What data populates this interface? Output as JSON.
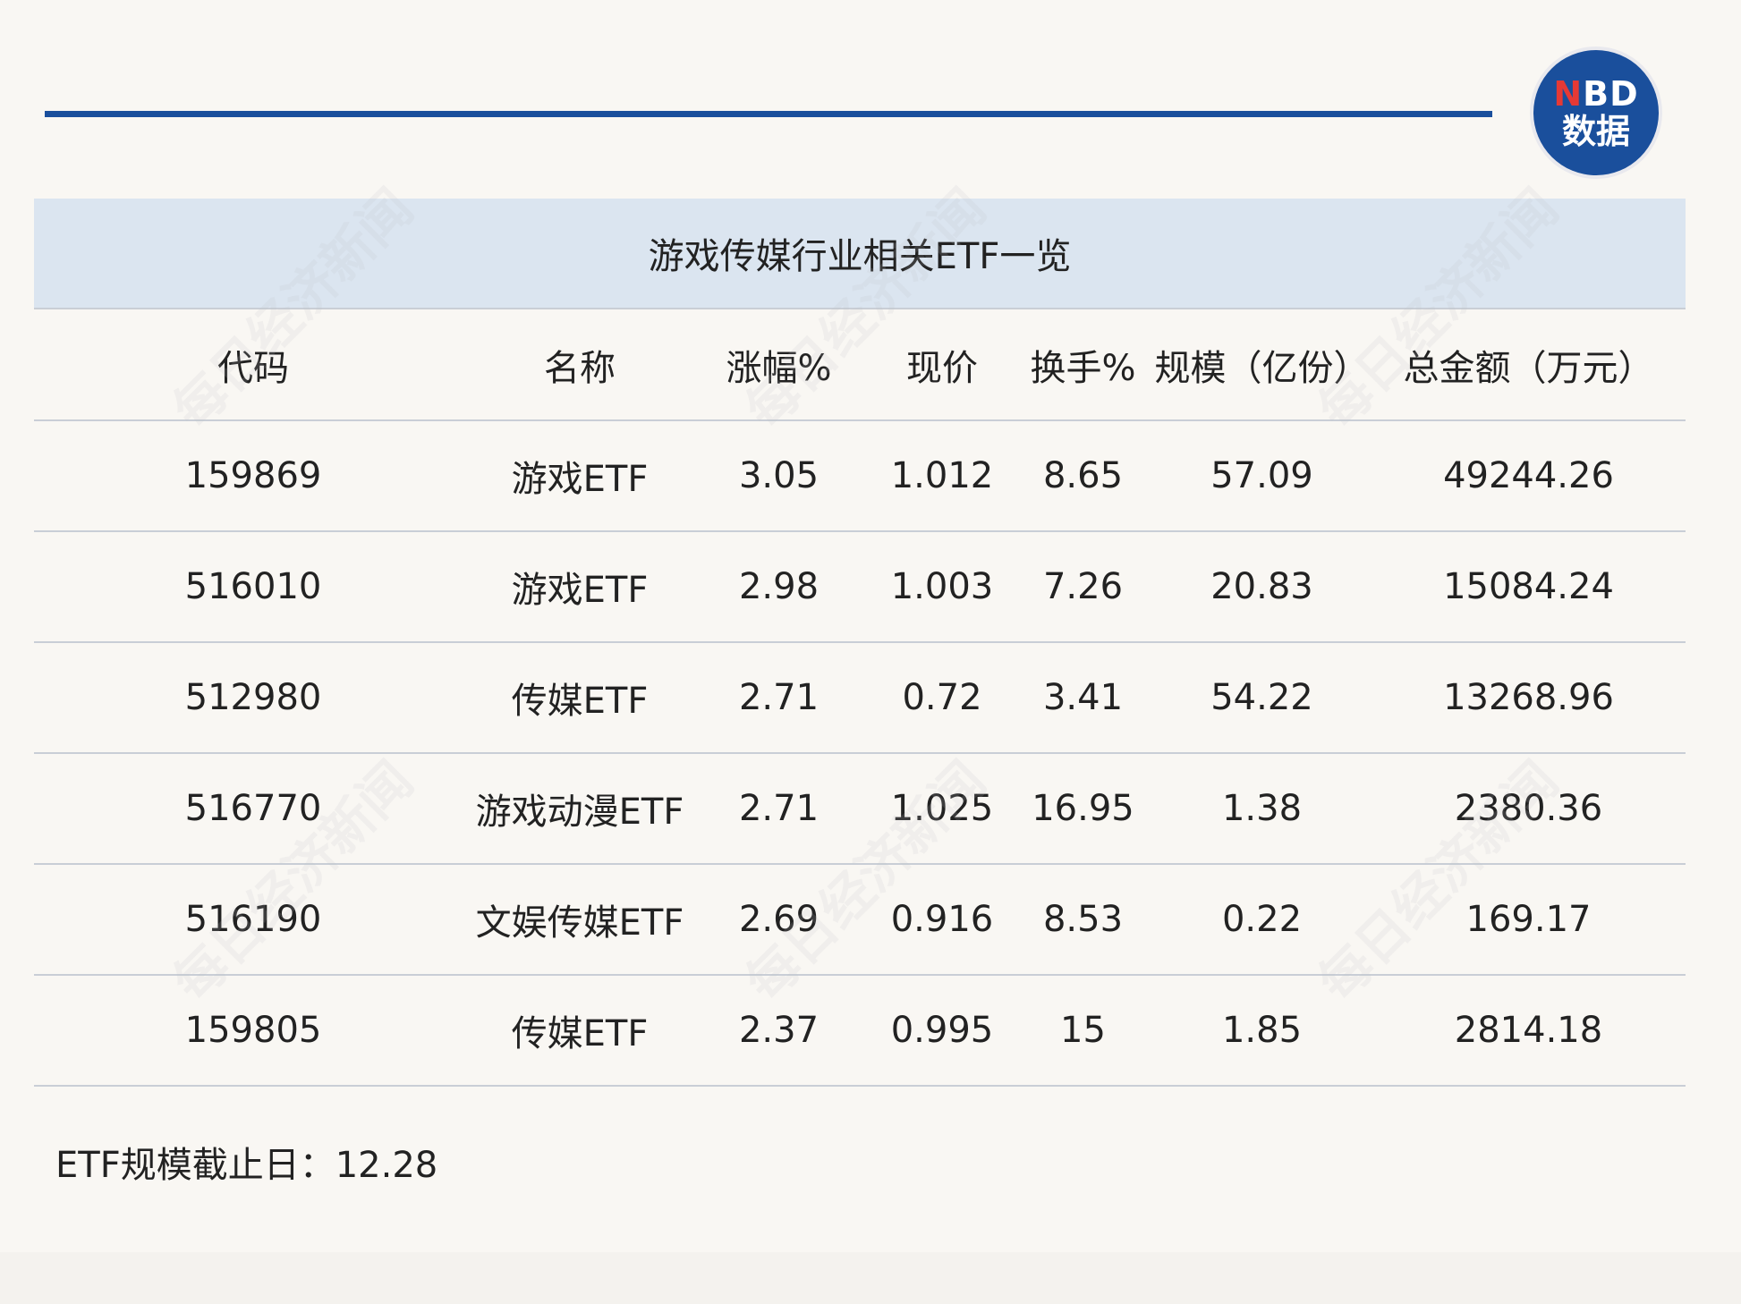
{
  "logo": {
    "latin_n": "N",
    "latin_rest": "BD",
    "cn": "数据"
  },
  "title": "游戏传媒行业相关ETF一览",
  "table": {
    "headers": [
      "代码",
      "名称",
      "涨幅%",
      "现价",
      "换手%",
      "规模（亿份）",
      "总金额（万元）"
    ],
    "rows": [
      [
        "159869",
        "游戏ETF",
        "3.05",
        "1.012",
        "8.65",
        "57.09",
        "49244.26"
      ],
      [
        "516010",
        "游戏ETF",
        "2.98",
        "1.003",
        "7.26",
        "20.83",
        "15084.24"
      ],
      [
        "512980",
        "传媒ETF",
        "2.71",
        "0.72",
        "3.41",
        "54.22",
        "13268.96"
      ],
      [
        "516770",
        "游戏动漫ETF",
        "2.71",
        "1.025",
        "16.95",
        "1.38",
        "2380.36"
      ],
      [
        "516190",
        "文娱传媒ETF",
        "2.69",
        "0.916",
        "8.53",
        "0.22",
        "169.17"
      ],
      [
        "159805",
        "传媒ETF",
        "2.37",
        "0.995",
        "15",
        "1.85",
        "2814.18"
      ]
    ]
  },
  "footnote": "ETF规模截止日：12.28",
  "watermark": "每日经济新闻"
}
